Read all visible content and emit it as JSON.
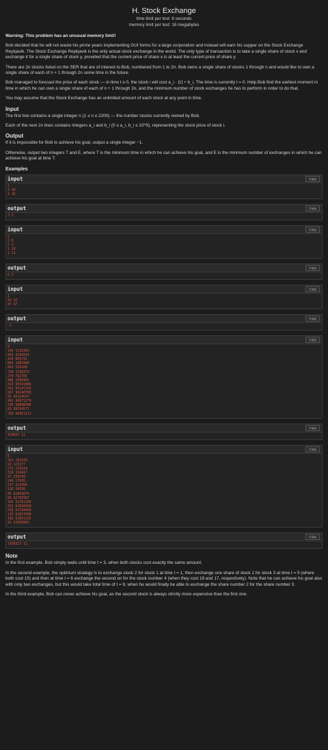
{
  "header": {
    "title": "H. Stock Exchange",
    "time_limit": "time limit per test: 6 seconds",
    "memory_limit": "memory limit per test: 16 megabytes"
  },
  "warning": "Warning: This problem has an unusual memory limit!",
  "statement": {
    "p1": "Bob decided that he will not waste his prime years implementing GUI forms for a large corporation and instead will earn his supper on the Stock Exchange Reykjavik. The Stock Exchange Reykjavik is the only actual stock exchange in the world. The only type of transaction is to take a single share of stock x and exchange it for a single share of stock y, provided that the current price of share x is at least the current price of share y.",
    "p2": "There are 2n stocks listed on the SER that are of interest to Bob, numbered from 1 to 2n. Bob owns a single share of stocks 1 through n and would like to own a single share of each of n + 1 through 2n some time in the future.",
    "p3": "Bob managed to forecast the price of each stock — in time t ≥ 0, the stock i will cost a_i · ⌊t⌋ + b_i. The time is currently t = 0. Help Bob find the earliest moment in time in which he can own a single share of each of n + 1 through 2n, and the minimum number of stock exchanges he has to perform in order to do that.",
    "p4": "You may assume that the Stock Exchange has an unlimited amount of each stock at any point in time."
  },
  "input_section": {
    "heading": "Input",
    "p1": "The first line contains a single integer n (1 ≤ n ≤ 2200) — the number stocks currently owned by Bob.",
    "p2": "Each of the next 2n lines contains integers a_i and b_i (0 ≤ a_i, b_i ≤ 10^9), representing the stock price of stock i."
  },
  "output_section": {
    "heading": "Output",
    "p1": "If it is impossible for Bob to achieve his goal, output a single integer −1.",
    "p2": "Otherwise, output two integers T and E, where T is the minimum time in which he can achieve his goal, and E is the minimum number of exchanges in which he can achieve his goal at time T."
  },
  "examples": {
    "heading": "Examples",
    "input_label": "input",
    "output_label": "output",
    "copy_label": "Copy",
    "items": [
      {
        "input": "1\n3 10\n1 16",
        "output": "3 1"
      },
      {
        "input": "2\n3 0\n2 1\n1 10\n1 11",
        "output": "6 3"
      },
      {
        "input": "1\n42 42\n47 47",
        "output": "-1"
      },
      {
        "input": "8\n145 1729363\n891 4194243\n424 853731\n869 1883440\n843 556108\n760 1538373\n270 762781\n986 2589382\n610 99315884\n591 95147193\n687 99248788\n65 95114537\n481 99071279\n293 98888998\n83 99764577\n769 96951171",
        "output": "434847 11"
      },
      {
        "input": "8\n261 261639\n92 123277\n271 131614\n320 154417\n97 258799\n246 17926\n117 222490\n110 39356\n85 62864876\n86 62781907\n165 62761166\n252 62828168\n258 62794649\n125 62817698\n182 62651225\n16 62856001",
        "output": "1030327 11"
      }
    ]
  },
  "note": {
    "heading": "Note",
    "p1": "In the first example, Bob simply waits until time t = 3, when both stocks cost exactly the same amount.",
    "p2": "In the second example, the optimum strategy is to exchange stock 2 for stock 1 at time t = 1, then exchange one share of stock 1 for stock 3 at time t = 5 (where both cost 15) and then at time t = 6 exchange the second on for the stock number 4 (when they cost 18 and 17, respectively). Note that he can achieve his goal also with only two exchanges, but this would take total time of t = 9, when he would finally be able to exchange the share number 2 for the share number 3.",
    "p3": "In the third example, Bob can never achieve his goal, as the second stock is always strictly more expensive than the first one."
  }
}
